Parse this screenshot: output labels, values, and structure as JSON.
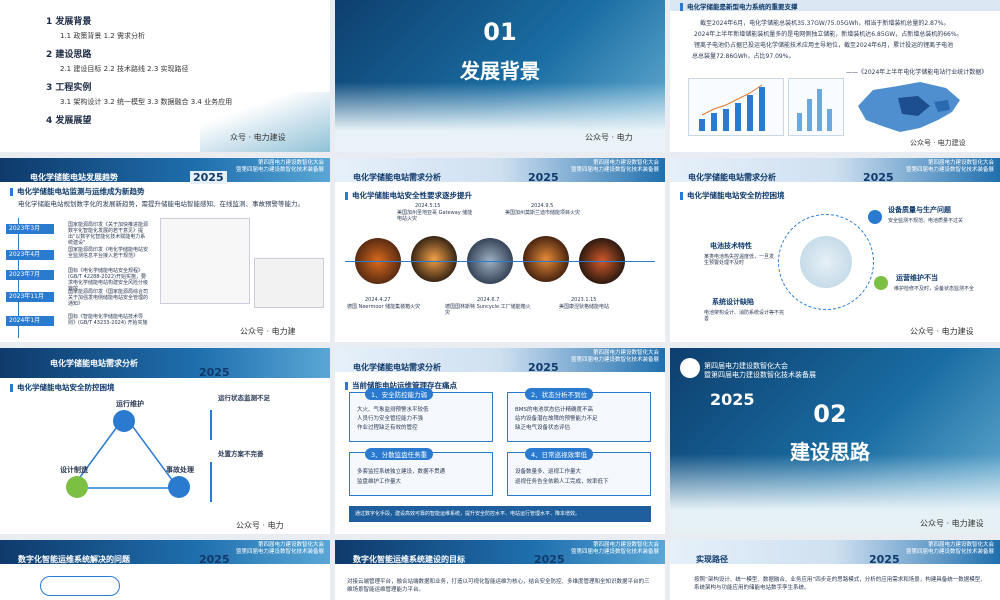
{
  "s1": {
    "items": [
      {
        "num": "1",
        "title": "发展背景",
        "sub": "1.1 政策背景 1.2 需求分析"
      },
      {
        "num": "2",
        "title": "建设思路",
        "sub": "2.1  建设目标 2.2 技术路线 2.3 实现路径"
      },
      {
        "num": "3",
        "title": "工程实例",
        "sub": "3.1 架构设计 3.2 统一模型 3.3 数据融合 3.4 业务应用"
      },
      {
        "num": "4",
        "title": "发展展望",
        "sub": ""
      }
    ],
    "watermark": "众号 · 电力建设"
  },
  "s2": {
    "num": "01",
    "title": "发展背景",
    "watermark": "公众号 · 电力"
  },
  "s3": {
    "title": "电化学储能是新型电力系统的重要支撑",
    "lines": [
      "截至2024年6月，电化学储能总装机35.37GW/75.05GWh，相当于新增装机总量的2.87%。",
      "2024年上半年新增储能装机量多的是电网侧独立储能，新增装机达6.85GW，占新增总装机的66%。",
      "锂离子电池仍占据已投运电化学储能技术应用主导地位，截至2024年6月，累计投运的锂离子电池",
      "总总装量72.86GWh，占比97.09%。"
    ],
    "caption": "——《2024年上半年电化学储能电站行业统计数据》",
    "watermark": "公众号 · 电力建设"
  },
  "conf_line1": "第四届电力建设数智化大会",
  "conf_line2": "暨第四届电力建设数智化技术装备展",
  "year": "2025",
  "s4": {
    "header": "电化学储能电站发展趋势",
    "section": "电化学储能电站监测与运维成为新趋势",
    "intro": "电化学储能电站规划数字化的发展新趋势，需提升储能电站智能感知、在线监测、事故预警等能力。",
    "timeline": [
      {
        "date": "2023年3月",
        "text": "国家能源局印发《关于加快推进能源数字化智能化发展的若干意见》提出\"以数字化智能化技术赋能电力系统建设\""
      },
      {
        "date": "2023年4月",
        "text": "国家能源局印发《电化学储能电站安全监测信息平台接入若干规范》"
      },
      {
        "date": "2023年7月",
        "text": "国标《电化学储能电站安全规程》(GB/T 42288-2022)开始实施，要求电化学储能电站构建安全风险分级管控"
      },
      {
        "date": "2023年11月",
        "text": "国家能源局印发《国家能源局综合司关于加强发电侧储能电站安全管理的通知》"
      },
      {
        "date": "2024年1月",
        "text": "国标《智能电化学储能电站技术导则》(GB/T 43233-2024) 开始实施"
      }
    ],
    "watermark": "公众号 · 电力建"
  },
  "s5": {
    "header": "电化学储能电站需求分析",
    "section": "电化学储能电站安全性要求逐步提升",
    "events_top": [
      {
        "date": "2024.5.15",
        "text": "美国加州圣地亚哥 Gateway 储能电站火灾"
      },
      {
        "date": "2024.9.5",
        "text": "美国加州莫斯兰迪市储能项目火灾"
      }
    ],
    "events_bottom": [
      {
        "date": "2024.4.27",
        "text": "德国 Neermoor 储能集装箱火灾"
      },
      {
        "date": "2024.6.7",
        "text": "德国国林斯特 Suncycle 工厂储能箱火灾"
      },
      {
        "date": "2023.1.15",
        "text": "美国康涅狄格储能电站"
      }
    ]
  },
  "s6": {
    "header": "电化学储能电站需求分析",
    "section": "电化学储能电站安全防控困境",
    "labels": [
      "设备质量与生产问题",
      "电池技术特性",
      "运营维护不当",
      "系统设计缺陷"
    ],
    "descs": [
      "安全监测不规范、电池质量不过关",
      "某类电池热失控温度低，一旦发生预警处理不及时",
      "维护检修不及时，设备状态监测不全",
      "电池架构设计、消防系统设计等不完善"
    ],
    "watermark": "公众号 · 电力建设"
  },
  "s7": {
    "header": "电化学储能电站需求分析",
    "section": "电化学储能电站安全防控困境",
    "nodes": [
      "运行维护",
      "设计制造",
      "事故处理"
    ],
    "right_items": [
      "运行状态监测不足",
      "处置方案不完善"
    ],
    "watermark": "公众号 · 电力"
  },
  "s8": {
    "header": "电化学储能电站需求分析",
    "section": "当前储能电站运维管理存在痛点",
    "boxes": [
      {
        "title": "1、安全防控能力弱",
        "lines": [
          "大火、气象监测预警水平较低",
          "人员行为安全管控能力不强",
          "作业过程缺乏有效的管控"
        ]
      },
      {
        "title": "2、状态分析不到位",
        "lines": [
          "BMS的电池状态估计精确度不高",
          "站内设备潜在故障的预警能力不足",
          "缺乏电气设备状态评估"
        ]
      },
      {
        "title": "3、分散监盘任务重",
        "lines": [
          "多套监控系统独立建设，数据不贯通",
          "监盘维护工作量大"
        ]
      },
      {
        "title": "4、日常巡视效率低",
        "lines": [
          "设备数量多、巡视工作量大",
          "巡视任务告全依赖人工完成，效率低下"
        ]
      }
    ],
    "footer": "通过数字化手段，建设高效可靠的智能运维系统，提升安全防控水平、电站运行管理水平、降本增效。"
  },
  "s9": {
    "year": "2025",
    "num": "02",
    "title": "建设思路",
    "watermark": "公众号 · 电力建设"
  },
  "s10": {
    "header": "数字化智能运维系统解决的问题"
  },
  "s11": {
    "header": "数字化智能运维系统建设的目标",
    "text": "对接云端管理平台，融合站端数据和业务，打造以可视化智能运维为核心，结合安全防控、多维度管理和全知识数据平台的三维场景智能运维管理能力平台。"
  },
  "s12": {
    "header": "实现路径",
    "text": "按照“架构设计、统一模型、数据融合、业务应用”四步走的思路模式，分析的应用需求和场景，构建具备统一数据模型、系统架构与功能应用的储能电站数字孪生系统。"
  }
}
